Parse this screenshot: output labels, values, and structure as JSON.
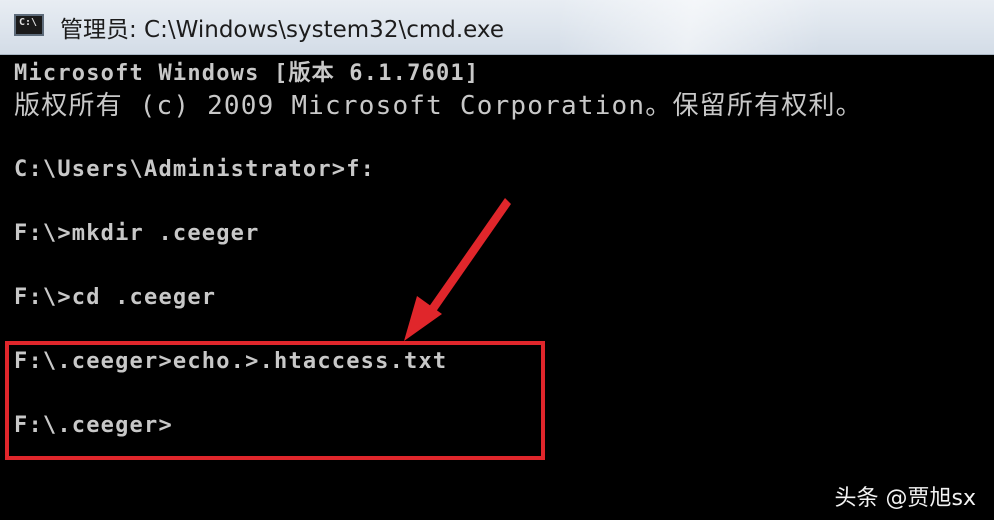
{
  "window": {
    "title": "管理员: C:\\Windows\\system32\\cmd.exe",
    "icon": "cmd-icon",
    "icon_text": "C:\\"
  },
  "console": {
    "lines": [
      "Microsoft Windows [版本 6.1.7601]",
      "版权所有 (c) 2009 Microsoft Corporation。保留所有权利。",
      "",
      "C:\\Users\\Administrator>f:",
      "",
      "F:\\>mkdir .ceeger",
      "",
      "F:\\>cd .ceeger",
      "",
      "F:\\.ceeger>echo.>.htaccess.txt",
      "",
      "F:\\.ceeger>"
    ]
  },
  "annotation": {
    "highlight_color": "#e0262b",
    "arrow": "red-arrow"
  },
  "watermark": {
    "text": "头条 @贾旭sx"
  }
}
